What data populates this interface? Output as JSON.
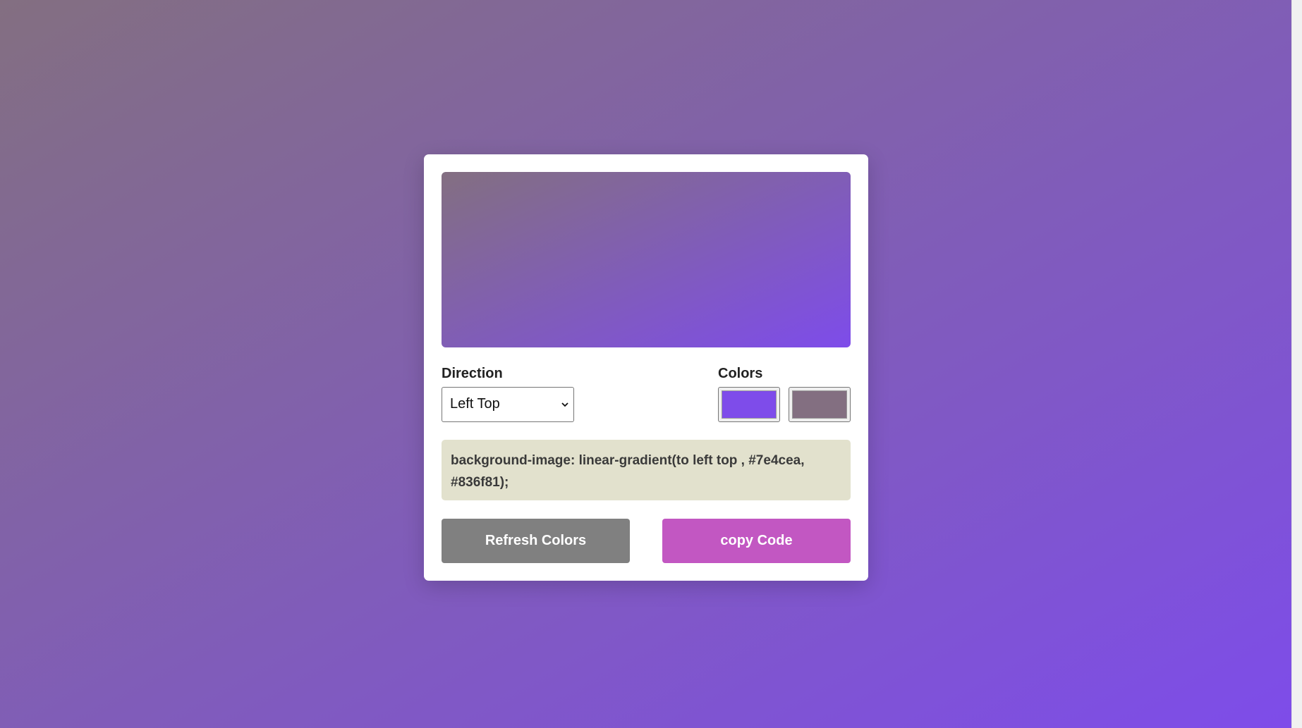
{
  "page": {
    "background_gradient": "linear-gradient(to left top, #7e4cea, #836f81)"
  },
  "preview": {
    "gradient": "linear-gradient(to left top, #7e4cea, #836f81)"
  },
  "direction": {
    "label": "Direction",
    "selected": "Left Top",
    "icon": "chevron-down-icon"
  },
  "colors": {
    "label": "Colors",
    "color1": "#7e4cea",
    "color2": "#836f81"
  },
  "code": {
    "text": "background-image: linear-gradient(to left top , #7e4cea, #836f81);"
  },
  "buttons": {
    "refresh_label": "Refresh Colors",
    "copy_label": "copy Code",
    "refresh_color": "#808080",
    "copy_color": "#c257c2"
  }
}
